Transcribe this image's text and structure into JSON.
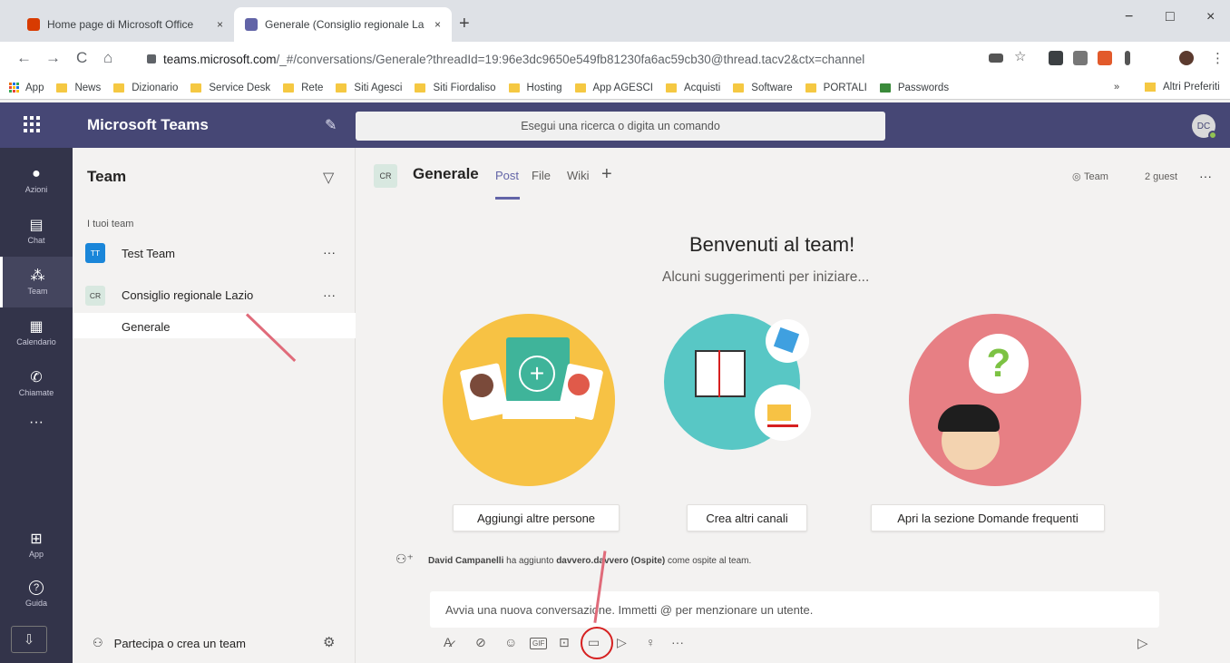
{
  "browser": {
    "tabs": [
      {
        "title": "Home page di Microsoft Office",
        "close": "×",
        "favicon_color": "#d83b01"
      },
      {
        "title": "Generale (Consiglio regionale La",
        "close": "×",
        "favicon_color": "#6264a7"
      }
    ],
    "new_tab": "+",
    "window_controls": [
      "−",
      "□",
      "×"
    ],
    "nav": {
      "back": "←",
      "forward": "→",
      "reload": "C",
      "home": "⌂"
    },
    "url_domain": "teams.microsoft.com",
    "url_rest": "/_#/conversations/Generale?threadId=19:96e3dc9650e549fb81230fa6ac59cb30@thread.tacv2&ctx=channel",
    "bookmarks": [
      "App",
      "News",
      "Dizionario",
      "Service Desk",
      "Rete",
      "Siti Agesci",
      "Siti Fiordaliso",
      "Hosting",
      "App AGESCI",
      "Acquisti",
      "Software",
      "PORTALI",
      "Passwords"
    ],
    "bookmarks_overflow": "»",
    "other_bookmarks": "Altri Preferiti"
  },
  "teams": {
    "app_title": "Microsoft Teams",
    "search_placeholder": "Esegui una ricerca o digita un comando",
    "user_initials": "DC",
    "accent": "#6264a7",
    "header_bg": "#464775",
    "rail": [
      {
        "label": "Azioni",
        "icon": "🔔"
      },
      {
        "label": "Chat",
        "icon": "▤"
      },
      {
        "label": "Team",
        "icon": "⁂"
      },
      {
        "label": "Calendario",
        "icon": "▦"
      },
      {
        "label": "Chiamate",
        "icon": "✆"
      },
      {
        "label": "",
        "icon": "···"
      }
    ],
    "rail_bottom": [
      {
        "label": "App",
        "icon": "⊞"
      },
      {
        "label": "Guida",
        "icon": "?"
      }
    ],
    "panel": {
      "title": "Team",
      "section": "I tuoi team",
      "teams": [
        {
          "initials": "TT",
          "name": "Test Team",
          "more": "···"
        },
        {
          "initials": "CR",
          "name": "Consiglio regionale Lazio",
          "more": "···"
        }
      ],
      "channel": "Generale",
      "join": "Partecipa o crea un team"
    },
    "channel": {
      "initials": "CR",
      "name": "Generale",
      "tabs": [
        "Post",
        "File",
        "Wiki"
      ],
      "add_tab": "+",
      "team_badge": "Team",
      "guests": "2 guest",
      "more": "···"
    },
    "welcome": {
      "title": "Benvenuti al team!",
      "subtitle": "Alcuni suggerimenti per iniziare..."
    },
    "actions": [
      "Aggiungi altre persone",
      "Crea altri canali",
      "Apri la sezione Domande frequenti"
    ],
    "system_message": {
      "actor": "David Campanelli",
      "verb": " ha aggiunto ",
      "target": "davvero.davvero (Ospite)",
      "suffix": " come ospite al team."
    },
    "compose_placeholder": "Avvia una nuova conversazione. Immetti @ per menzionare un utente.",
    "toolbar_icons": [
      "A̷",
      "⊘",
      "☺",
      "GIF",
      "⊡",
      "▭",
      "▷",
      "♀",
      "···"
    ],
    "send_icon": "▷"
  }
}
